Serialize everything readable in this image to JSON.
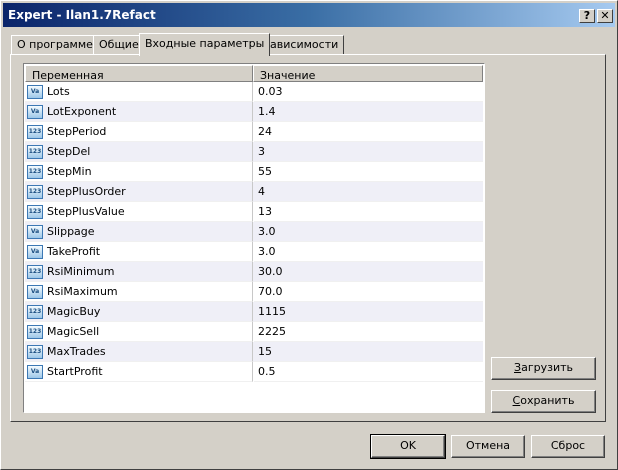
{
  "window": {
    "title": "Expert - Ilan1.7Refact",
    "help_label": "?",
    "close_label": "✕"
  },
  "tabs": [
    {
      "label": "О программе"
    },
    {
      "label": "Общие"
    },
    {
      "label": "Входные параметры",
      "active": true
    },
    {
      "label": "Зависимости"
    }
  ],
  "grid": {
    "columns": [
      "Переменная",
      "Значение"
    ],
    "rows": [
      {
        "icon": "value-icon",
        "icon_text": "Va",
        "name": "Lots",
        "value": "0.03"
      },
      {
        "icon": "value-icon",
        "icon_text": "Va",
        "name": "LotExponent",
        "value": "1.4"
      },
      {
        "icon": "integer-icon",
        "icon_text": "123",
        "name": "StepPeriod",
        "value": "24"
      },
      {
        "icon": "integer-icon",
        "icon_text": "123",
        "name": "StepDel",
        "value": "3"
      },
      {
        "icon": "integer-icon",
        "icon_text": "123",
        "name": "StepMin",
        "value": "55"
      },
      {
        "icon": "integer-icon",
        "icon_text": "123",
        "name": "StepPlusOrder",
        "value": "4"
      },
      {
        "icon": "integer-icon",
        "icon_text": "123",
        "name": "StepPlusValue",
        "value": "13"
      },
      {
        "icon": "value-icon",
        "icon_text": "Va",
        "name": "Slippage",
        "value": "3.0"
      },
      {
        "icon": "value-icon",
        "icon_text": "Va",
        "name": "TakeProfit",
        "value": "3.0"
      },
      {
        "icon": "integer-icon",
        "icon_text": "123",
        "name": "RsiMinimum",
        "value": "30.0"
      },
      {
        "icon": "value-icon",
        "icon_text": "Va",
        "name": "RsiMaximum",
        "value": "70.0"
      },
      {
        "icon": "integer-icon",
        "icon_text": "123",
        "name": "MagicBuy",
        "value": "1115"
      },
      {
        "icon": "integer-icon",
        "icon_text": "123",
        "name": "MagicSell",
        "value": "2225"
      },
      {
        "icon": "integer-icon",
        "icon_text": "123",
        "name": "MaxTrades",
        "value": "15"
      },
      {
        "icon": "value-icon",
        "icon_text": "Va",
        "name": "StartProfit",
        "value": "0.5"
      }
    ]
  },
  "side_buttons": {
    "load_label": "Загрузить",
    "load_mnemonic": "З",
    "load_rest": "агрузить",
    "save_label": "Сохранить",
    "save_mnemonic": "С",
    "save_rest": "охранить"
  },
  "footer": {
    "ok_label": "OK",
    "cancel_label": "Отмена",
    "reset_label": "Сброс"
  }
}
